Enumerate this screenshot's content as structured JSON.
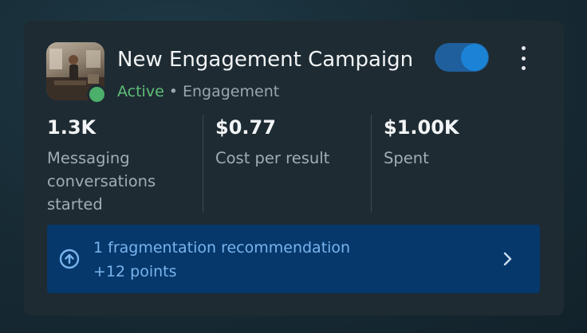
{
  "campaign": {
    "title": "New Engagement Campaign",
    "status": "Active",
    "separator": "•",
    "objective": "Engagement",
    "toggle_on": true
  },
  "metrics": [
    {
      "value": "1.3K",
      "label": "Messaging conversations started"
    },
    {
      "value": "$0.77",
      "label": "Cost per result"
    },
    {
      "value": "$1.00K",
      "label": "Spent"
    }
  ],
  "recommendation": {
    "title": "1 fragmentation recommendation",
    "points": "+12 points",
    "icon": "arrow-up-circle-icon"
  },
  "colors": {
    "card": "#1e2b33",
    "active_green": "#5fbf78",
    "toggle_track": "#1f5f9d",
    "toggle_knob": "#1b83d6",
    "recommendation_bg": "#06386b",
    "recommendation_text": "#79b4ee"
  }
}
